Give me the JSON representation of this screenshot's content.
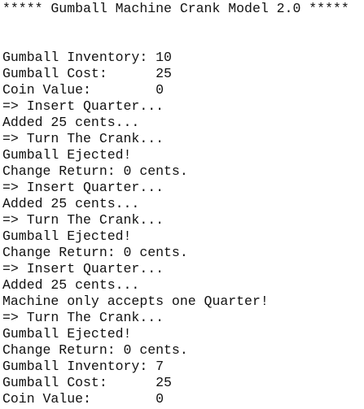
{
  "console": {
    "lines": [
      "***** Gumball Machine Crank Model 2.0 *****",
      "",
      "",
      "Gumball Inventory: 10",
      "Gumball Cost:      25",
      "Coin Value:        0",
      "=> Insert Quarter...",
      "Added 25 cents...",
      "=> Turn The Crank...",
      "Gumball Ejected!",
      "Change Return: 0 cents.",
      "=> Insert Quarter...",
      "Added 25 cents...",
      "=> Turn The Crank...",
      "Gumball Ejected!",
      "Change Return: 0 cents.",
      "=> Insert Quarter...",
      "Added 25 cents...",
      "Machine only accepts one Quarter!",
      "=> Turn The Crank...",
      "Gumball Ejected!",
      "Change Return: 0 cents.",
      "Gumball Inventory: 7",
      "Gumball Cost:      25",
      "Coin Value:        0"
    ]
  }
}
